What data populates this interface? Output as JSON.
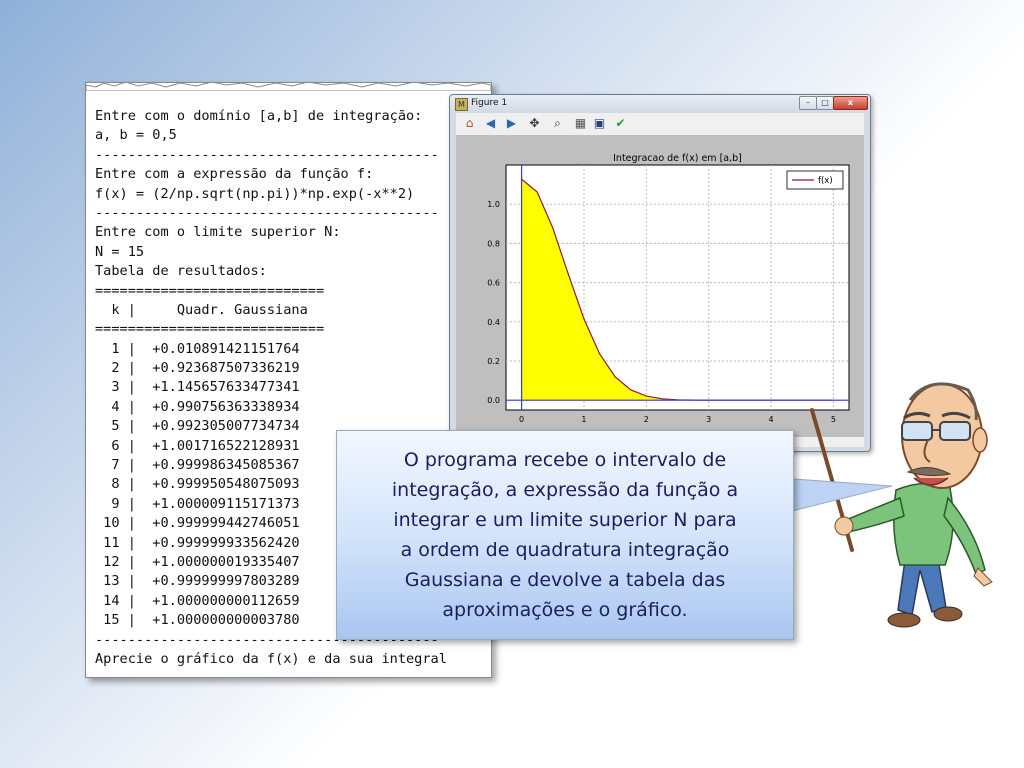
{
  "console": {
    "lines": [
      "Entre com o domínio [a,b] de integração:",
      "a, b = 0,5",
      "------------------------------------------",
      "Entre com a expressão da função f:",
      "f(x) = (2/np.sqrt(np.pi))*np.exp(-x**2)",
      "------------------------------------------",
      "Entre com o limite superior N:",
      "N = 15",
      "Tabela de resultados:",
      "============================",
      "  k |     Quadr. Gaussiana",
      "============================",
      "  1 |  +0.010891421151764",
      "  2 |  +0.923687507336219",
      "  3 |  +1.145657633477341",
      "  4 |  +0.990756363338934",
      "  5 |  +0.992305007734734",
      "  6 |  +1.001716522128931",
      "  7 |  +0.999986345085367",
      "  8 |  +0.999950548075093",
      "  9 |  +1.000009115171373",
      " 10 |  +0.999999442746051",
      " 11 |  +0.999999933562420",
      " 12 |  +1.000000019335407",
      " 13 |  +0.999999997803289",
      " 14 |  +1.000000000112659",
      " 15 |  +1.000000000003780",
      "------------------------------------------",
      "Aprecie o gráfico da f(x) e da sua integral"
    ]
  },
  "figure_window": {
    "title": "Figure 1",
    "icon_label": "M",
    "buttons": {
      "minimize": "–",
      "maximize": "□",
      "close": "x"
    },
    "toolbar": [
      {
        "name": "home-icon",
        "glyph": "⌂",
        "color": "#b0502a"
      },
      {
        "name": "back-icon",
        "glyph": "◀",
        "color": "#2a6aa8"
      },
      {
        "name": "forward-icon",
        "glyph": "▶",
        "color": "#2a6aa8"
      },
      {
        "name": "pan-icon",
        "glyph": "✥",
        "color": "#333333"
      },
      {
        "name": "zoom-icon",
        "glyph": "⌕",
        "color": "#333333"
      },
      {
        "name": "configure-icon",
        "glyph": "▦",
        "color": "#555555"
      },
      {
        "name": "save-icon",
        "glyph": "▣",
        "color": "#2a3f7a"
      },
      {
        "name": "check-icon",
        "glyph": "✔",
        "color": "#2a9a2a"
      }
    ]
  },
  "chart_data": {
    "type": "area",
    "title": "Integracao de f(x) em [a,b]",
    "xlabel": "",
    "ylabel": "",
    "xlim": [
      -0.25,
      5.25
    ],
    "ylim": [
      -0.05,
      1.2
    ],
    "xticks": [
      "0",
      "1",
      "2",
      "3",
      "4",
      "5"
    ],
    "yticks": [
      "0.0",
      "0.2",
      "0.4",
      "0.6",
      "0.8",
      "1.0"
    ],
    "grid": true,
    "legend_position": "top-right",
    "fill_color": "#ffff00",
    "line_color": "#8b1a3a",
    "series": [
      {
        "name": "f(x)",
        "x": [
          0,
          0.25,
          0.5,
          0.75,
          1.0,
          1.25,
          1.5,
          1.75,
          2.0,
          2.25,
          2.5,
          2.75,
          3.0,
          3.5,
          4.0,
          4.5,
          5.0
        ],
        "y": [
          1.128,
          1.062,
          0.879,
          0.642,
          0.415,
          0.237,
          0.119,
          0.053,
          0.021,
          0.007,
          0.002,
          0.0006,
          0.0001,
          0.0,
          0.0,
          0.0,
          0.0
        ]
      }
    ]
  },
  "bubble": {
    "text_lines": [
      "O programa recebe o intervalo de",
      "integração, a expressão da função a",
      "integrar e um limite superior N para",
      "a ordem de quadratura integração",
      "Gaussiana e devolve a tabela das",
      "aproximações e o gráfico."
    ]
  },
  "colors": {
    "bubble_text": "#1b1f5e",
    "console_text": "#111111"
  }
}
